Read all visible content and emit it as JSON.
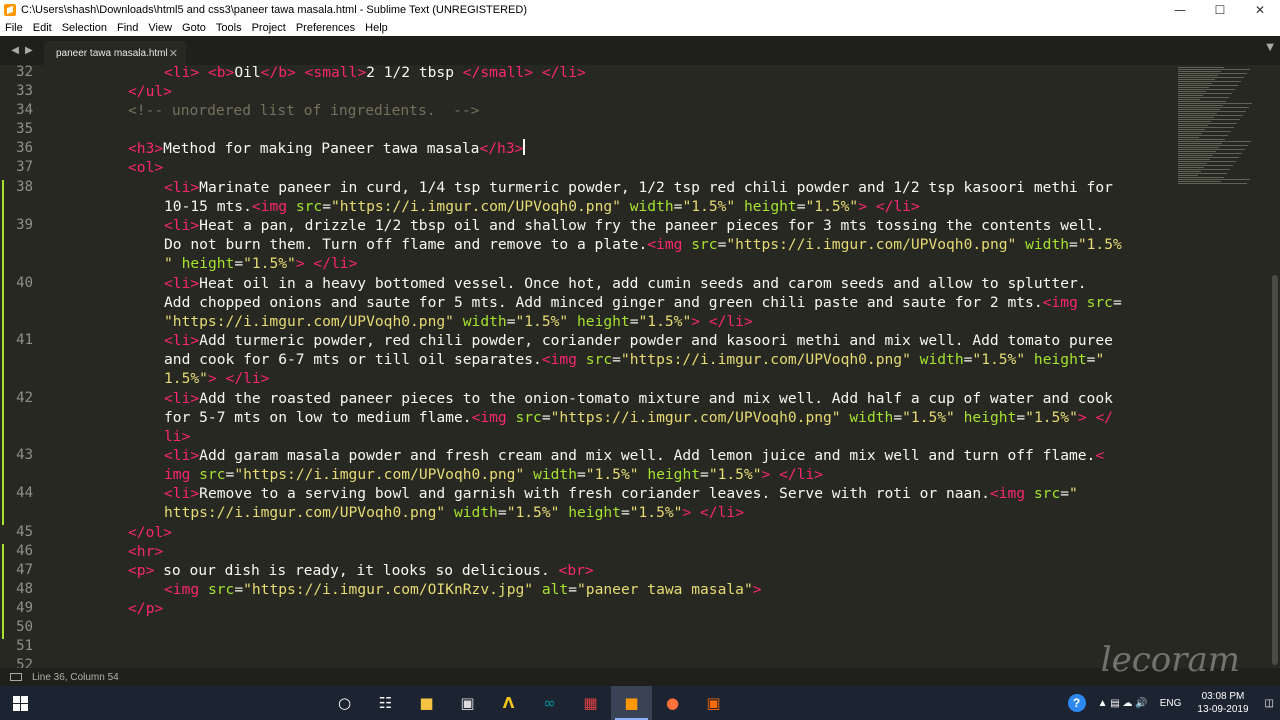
{
  "window": {
    "title": "C:\\Users\\shash\\Downloads\\html5 and css3\\paneer tawa masala.html - Sublime Text (UNREGISTERED)",
    "minimize_icon": "minimize-icon",
    "maximize_icon": "maximize-icon",
    "close_icon": "close-icon"
  },
  "menu": [
    "File",
    "Edit",
    "Selection",
    "Find",
    "View",
    "Goto",
    "Tools",
    "Project",
    "Preferences",
    "Help"
  ],
  "tabs": [
    {
      "label": "paneer tawa masala.html",
      "active": true
    }
  ],
  "colors": {
    "background": "#272822",
    "tag": "#f92672",
    "attribute": "#a6e22e",
    "string": "#e6db74",
    "comment": "#75715e",
    "text": "#f8f8f2"
  },
  "gutter": {
    "line_numbers": [
      "32",
      "33",
      "34",
      "35",
      "36",
      "37",
      "38",
      "39",
      "40",
      "41",
      "42",
      "43",
      "44",
      "45",
      "46",
      "47",
      "48",
      "49",
      "50",
      "51",
      "52"
    ]
  },
  "status": {
    "position": "Line 36, Column 54",
    "watermark": "lecoram"
  },
  "taskbar": {
    "time": "03:08 PM",
    "date": "13-09-2019",
    "language": "ENG",
    "help": "?"
  }
}
